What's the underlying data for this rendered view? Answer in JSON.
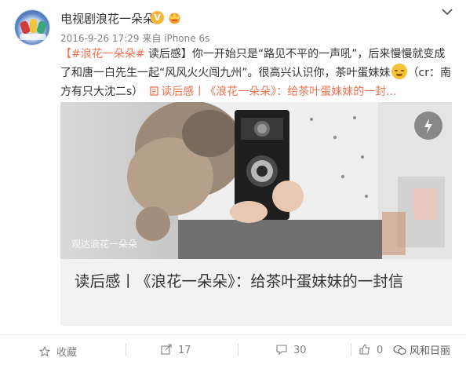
{
  "post": {
    "author": "电视剧浪花一朵朵",
    "timestamp": "2016-9-26 17:29 来自 iPhone 6s",
    "hashtag": "#浪花一朵朵#",
    "text_part1": " 读后感】你一开始只是“路见不平的一声吼”，后来慢慢就变成了和唐一白先生一起“风风火火闯九州”。很高兴认识你，茶叶蛋妹妹",
    "bracket_open": "【",
    "text_part2": "（cr：南方有只大沈二s）",
    "link_text": "读后感丨《浪花一朵朵》：给茶叶蛋妹妹的一封...",
    "emoji": "smile-emoji"
  },
  "card": {
    "watermark": "观达浪花一朵朵",
    "title": "读后感丨《浪花一朵朵》：给茶叶蛋妹妹的一封信"
  },
  "actions": {
    "favorite_label": "收藏",
    "repost_count": "17",
    "comment_count": "30",
    "like_count": "0"
  },
  "watermark_brand": "风和日丽",
  "colors": {
    "accent": "#eb7350",
    "text": "#333333",
    "muted": "#808080"
  }
}
